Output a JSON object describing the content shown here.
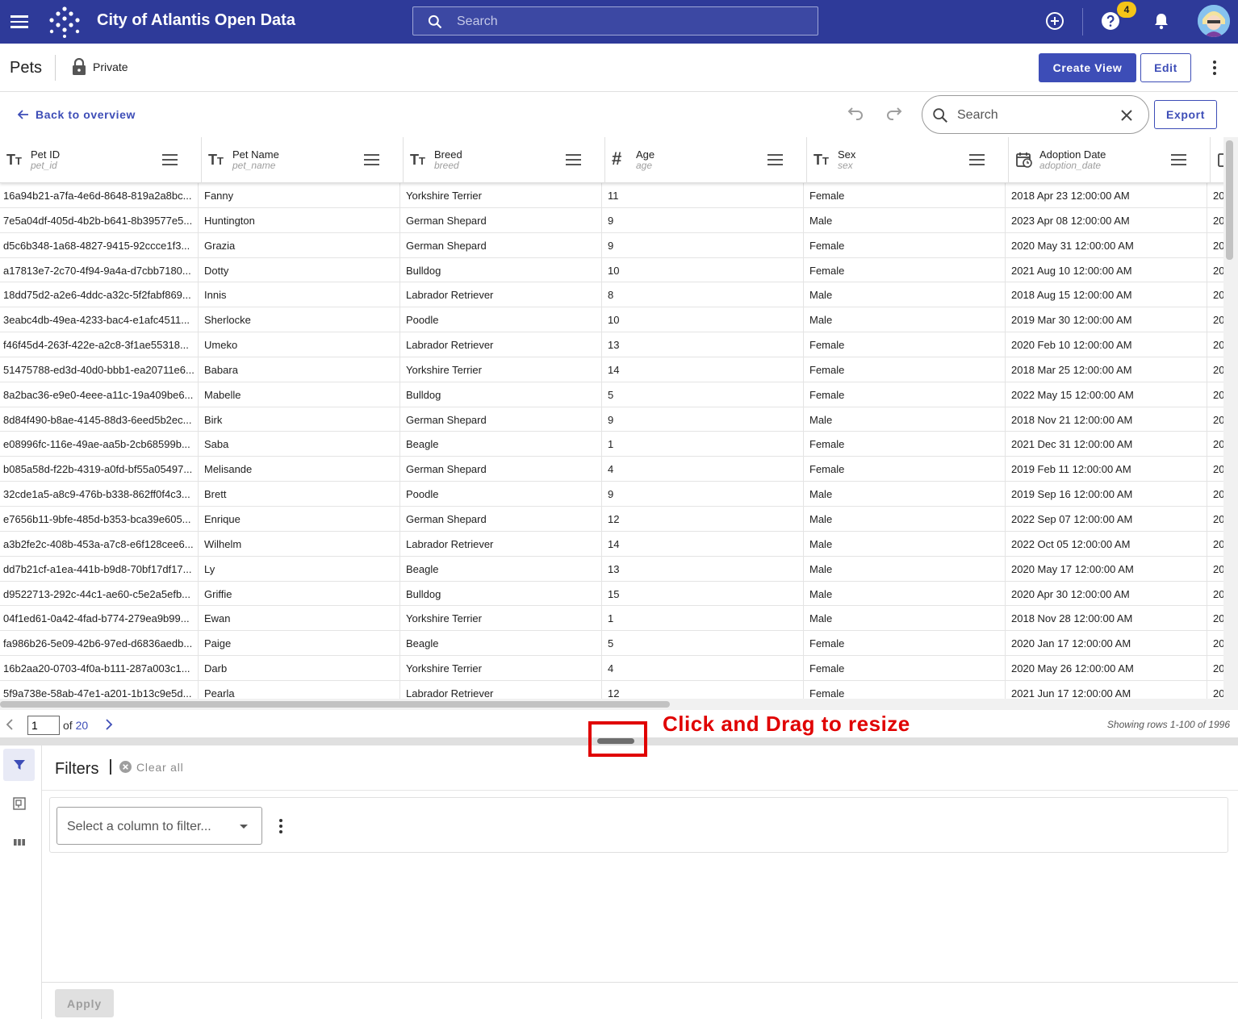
{
  "app": {
    "title": "City of Atlantis Open Data",
    "search_placeholder": "Search",
    "help_badge": "4"
  },
  "page": {
    "title": "Pets",
    "privacy": "Private",
    "create_view_label": "Create View",
    "edit_label": "Edit"
  },
  "toolbar": {
    "back_label": "Back to overview",
    "search_placeholder": "Search",
    "export_label": "Export"
  },
  "columns": [
    {
      "name": "Pet ID",
      "field": "pet_id",
      "type_icon": "text-type-icon"
    },
    {
      "name": "Pet Name",
      "field": "pet_name",
      "type_icon": "text-type-icon"
    },
    {
      "name": "Breed",
      "field": "breed",
      "type_icon": "text-type-icon"
    },
    {
      "name": "Age",
      "field": "age",
      "type_icon": "number-type-icon"
    },
    {
      "name": "Sex",
      "field": "sex",
      "type_icon": "text-type-icon"
    },
    {
      "name": "Adoption Date",
      "field": "adoption_date",
      "type_icon": "calendar-type-icon"
    }
  ],
  "rows": [
    [
      "16a94b21-a7fa-4e6d-8648-819a2a8bc...",
      "Fanny",
      "Yorkshire Terrier",
      "11",
      "Female",
      "2018 Apr 23 12:00:00 AM",
      "20"
    ],
    [
      "7e5a04df-405d-4b2b-b641-8b39577e5...",
      "Huntington",
      "German Shepard",
      "9",
      "Male",
      "2023 Apr 08 12:00:00 AM",
      "20"
    ],
    [
      "d5c6b348-1a68-4827-9415-92ccce1f3...",
      "Grazia",
      "German Shepard",
      "9",
      "Female",
      "2020 May 31 12:00:00 AM",
      "20"
    ],
    [
      "a17813e7-2c70-4f94-9a4a-d7cbb7180...",
      "Dotty",
      "Bulldog",
      "10",
      "Female",
      "2021 Aug 10 12:00:00 AM",
      "20"
    ],
    [
      "18dd75d2-a2e6-4ddc-a32c-5f2fabf869...",
      "Innis",
      "Labrador Retriever",
      "8",
      "Male",
      "2018 Aug 15 12:00:00 AM",
      "20"
    ],
    [
      "3eabc4db-49ea-4233-bac4-e1afc4511...",
      "Sherlocke",
      "Poodle",
      "10",
      "Male",
      "2019 Mar 30 12:00:00 AM",
      "20"
    ],
    [
      "f46f45d4-263f-422e-a2c8-3f1ae55318...",
      "Umeko",
      "Labrador Retriever",
      "13",
      "Female",
      "2020 Feb 10 12:00:00 AM",
      "20"
    ],
    [
      "51475788-ed3d-40d0-bbb1-ea20711e6...",
      "Babara",
      "Yorkshire Terrier",
      "14",
      "Female",
      "2018 Mar 25 12:00:00 AM",
      "20"
    ],
    [
      "8a2bac36-e9e0-4eee-a11c-19a409be6...",
      "Mabelle",
      "Bulldog",
      "5",
      "Female",
      "2022 May 15 12:00:00 AM",
      "20"
    ],
    [
      "8d84f490-b8ae-4145-88d3-6eed5b2ec...",
      "Birk",
      "German Shepard",
      "9",
      "Male",
      "2018 Nov 21 12:00:00 AM",
      "20"
    ],
    [
      "e08996fc-116e-49ae-aa5b-2cb68599b...",
      "Saba",
      "Beagle",
      "1",
      "Female",
      "2021 Dec 31 12:00:00 AM",
      "20"
    ],
    [
      "b085a58d-f22b-4319-a0fd-bf55a05497...",
      "Melisande",
      "German Shepard",
      "4",
      "Female",
      "2019 Feb 11 12:00:00 AM",
      "20"
    ],
    [
      "32cde1a5-a8c9-476b-b338-862ff0f4c3...",
      "Brett",
      "Poodle",
      "9",
      "Male",
      "2019 Sep 16 12:00:00 AM",
      "20"
    ],
    [
      "e7656b11-9bfe-485d-b353-bca39e605...",
      "Enrique",
      "German Shepard",
      "12",
      "Male",
      "2022 Sep 07 12:00:00 AM",
      "20"
    ],
    [
      "a3b2fe2c-408b-453a-a7c8-e6f128cee6...",
      "Wilhelm",
      "Labrador Retriever",
      "14",
      "Male",
      "2022 Oct 05 12:00:00 AM",
      "20"
    ],
    [
      "dd7b21cf-a1ea-441b-b9d8-70bf17df17...",
      "Ly",
      "Beagle",
      "13",
      "Male",
      "2020 May 17 12:00:00 AM",
      "20"
    ],
    [
      "d9522713-292c-44c1-ae60-c5e2a5efb...",
      "Griffie",
      "Bulldog",
      "15",
      "Male",
      "2020 Apr 30 12:00:00 AM",
      "20"
    ],
    [
      "04f1ed61-0a42-4fad-b774-279ea9b99...",
      "Ewan",
      "Yorkshire Terrier",
      "1",
      "Male",
      "2018 Nov 28 12:00:00 AM",
      "20"
    ],
    [
      "fa986b26-5e09-42b6-97ed-d6836aedb...",
      "Paige",
      "Beagle",
      "5",
      "Female",
      "2020 Jan 17 12:00:00 AM",
      "20"
    ],
    [
      "16b2aa20-0703-4f0a-b111-287a003c1...",
      "Darb",
      "Yorkshire Terrier",
      "4",
      "Female",
      "2020 May 26 12:00:00 AM",
      "20"
    ],
    [
      "5f9a738e-58ab-47e1-a201-1b13c9e5d...",
      "Pearla",
      "Labrador Retriever",
      "12",
      "Female",
      "2021 Jun 17 12:00:00 AM",
      "20"
    ]
  ],
  "pager": {
    "page_value": "1",
    "of_label": "of",
    "total_pages": "20",
    "rows_info": "Showing rows 1-100 of 1996"
  },
  "annotation": {
    "text": "Click and Drag to resize"
  },
  "filters": {
    "title": "Filters",
    "clear_all_label": "Clear all",
    "select_placeholder": "Select a column to filter...",
    "apply_label": "Apply"
  },
  "colors": {
    "brand": "#2e3a99",
    "accent": "#3d4db7",
    "annotation": "#e00000",
    "badge": "#f5c518"
  }
}
